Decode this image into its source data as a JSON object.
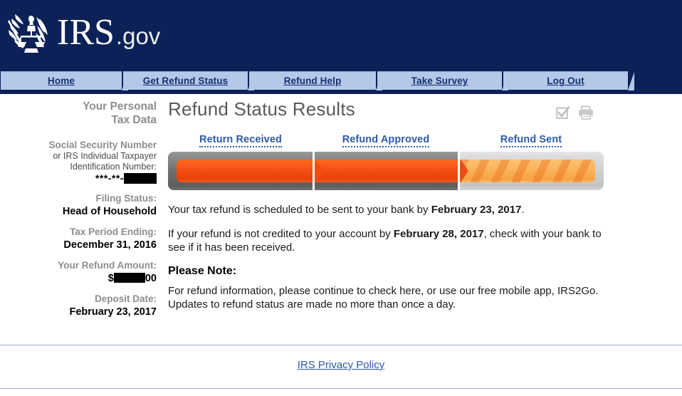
{
  "site": {
    "brand_primary": "IRS",
    "brand_suffix": ".gov",
    "seal_alt": "irs-seal",
    "header_bg": "#0b2157",
    "nav_tab_bg": "#b6c8e9",
    "link_color": "#2c5aa8"
  },
  "nav": {
    "items": [
      {
        "label": "Home"
      },
      {
        "label": "Get Refund Status"
      },
      {
        "label": "Refund Help"
      },
      {
        "label": "Take Survey"
      },
      {
        "label": "Log Out"
      }
    ]
  },
  "sidebar": {
    "title_line1": "Your Personal",
    "title_line2": "Tax Data",
    "fields": [
      {
        "label": "Social Security Number",
        "sublabel_line1": "or IRS Individual Taxpayer",
        "sublabel_line2": "Identification Number:",
        "value": "***-**-",
        "redacted": true
      },
      {
        "label": "Filing Status:",
        "value": "Head of Household"
      },
      {
        "label": "Tax Period Ending:",
        "value": "December 31, 2016"
      },
      {
        "label": "Your Refund Amount:",
        "value_prefix": "$",
        "value_suffix": "00",
        "redacted": true
      },
      {
        "label": "Deposit Date:",
        "value": "February 23, 2017"
      }
    ]
  },
  "main": {
    "title": "Refund Status Results",
    "icons": [
      {
        "name": "checkbox-checked-icon"
      },
      {
        "name": "printer-icon"
      }
    ],
    "tracker": {
      "steps": [
        {
          "label": "Return Received",
          "state": "complete"
        },
        {
          "label": "Refund Approved",
          "state": "complete"
        },
        {
          "label": "Refund Sent",
          "state": "in-progress"
        }
      ]
    },
    "paragraphs": [
      {
        "before": "Your tax refund is scheduled to be sent to your bank by ",
        "bold": "February 23, 2017",
        "after": "."
      },
      {
        "before": "If your refund is not credited to your account by ",
        "bold": "February 28, 2017",
        "after": ", check with your bank to see if it has been received."
      }
    ],
    "note": {
      "heading": "Please Note:",
      "text": "For refund information, please continue to check here, or use our free mobile app, IRS2Go. Updates to refund status are made no more than once a day."
    }
  },
  "footer": {
    "privacy_link": "IRS Privacy Policy"
  }
}
